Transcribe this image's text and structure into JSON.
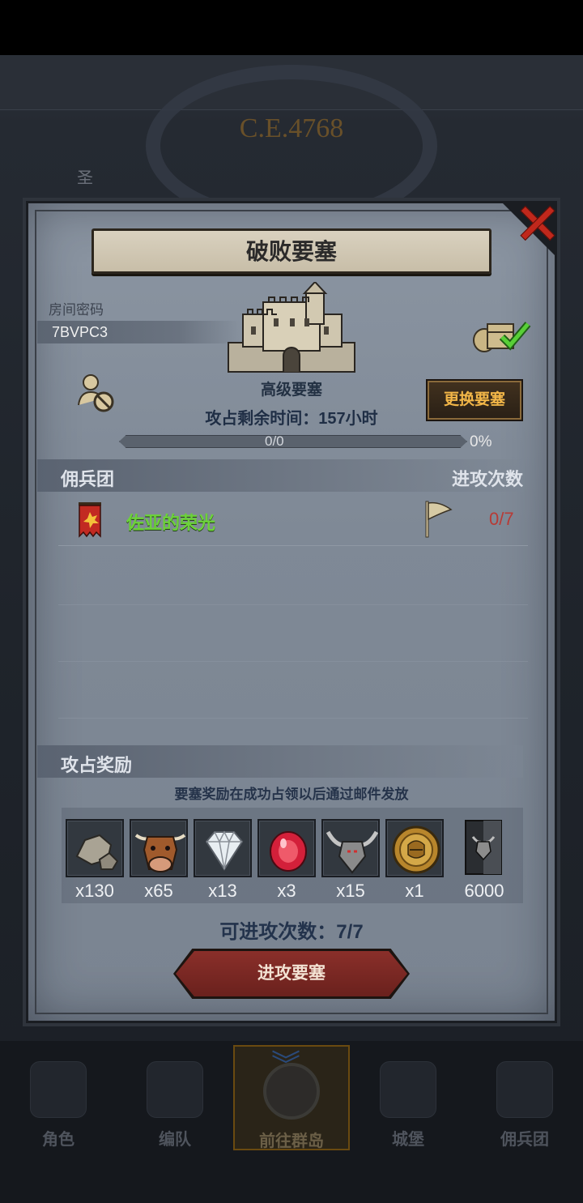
{
  "background": {
    "era_label": "C.E.4768",
    "left_label": "圣"
  },
  "modal": {
    "title": "破败要塞",
    "room": {
      "label": "房间密码",
      "code": "7BVPC3"
    },
    "fortress": {
      "name": "高级要塞",
      "remaining_time": "攻占剩余时间：157小时",
      "change_button": "更换要塞",
      "progress_text": "0/0",
      "progress_percent": "0%",
      "progress_fraction": 0
    },
    "mercenary_section": {
      "left_header": "佣兵团",
      "right_header": "进攻次数",
      "rows": [
        {
          "name": "佐亚的荣光",
          "count": "0/7"
        }
      ]
    },
    "reward_section": {
      "header": "攻占奖励",
      "note": "要塞奖励在成功占领以后通过邮件发放",
      "items": [
        {
          "icon": "stone-icon",
          "qty": "x130"
        },
        {
          "icon": "cow-icon",
          "qty": "x65"
        },
        {
          "icon": "diamond-icon",
          "qty": "x13"
        },
        {
          "icon": "ruby-icon",
          "qty": "x3"
        },
        {
          "icon": "horned-helmet-icon",
          "qty": "x15"
        },
        {
          "icon": "gold-medal-icon",
          "qty": "x1"
        },
        {
          "icon": "bull-banner-icon",
          "qty": "6000"
        }
      ]
    },
    "attempts": "可进攻次数：7/7",
    "attack_button": "进攻要塞"
  },
  "bottom_nav": {
    "items": [
      {
        "label": "角色",
        "icon": "knight-icon"
      },
      {
        "label": "编队",
        "icon": "helmet-icon"
      },
      {
        "label": "前往群岛",
        "icon": "compass-icon"
      },
      {
        "label": "城堡",
        "icon": "castle-icon"
      },
      {
        "label": "佣兵团",
        "icon": "mercenary-icon"
      }
    ]
  },
  "colors": {
    "accent_gold": "#f2b648",
    "merc_green": "#6cd23a",
    "count_red": "#b83a35",
    "close_red": "#c0281c"
  }
}
